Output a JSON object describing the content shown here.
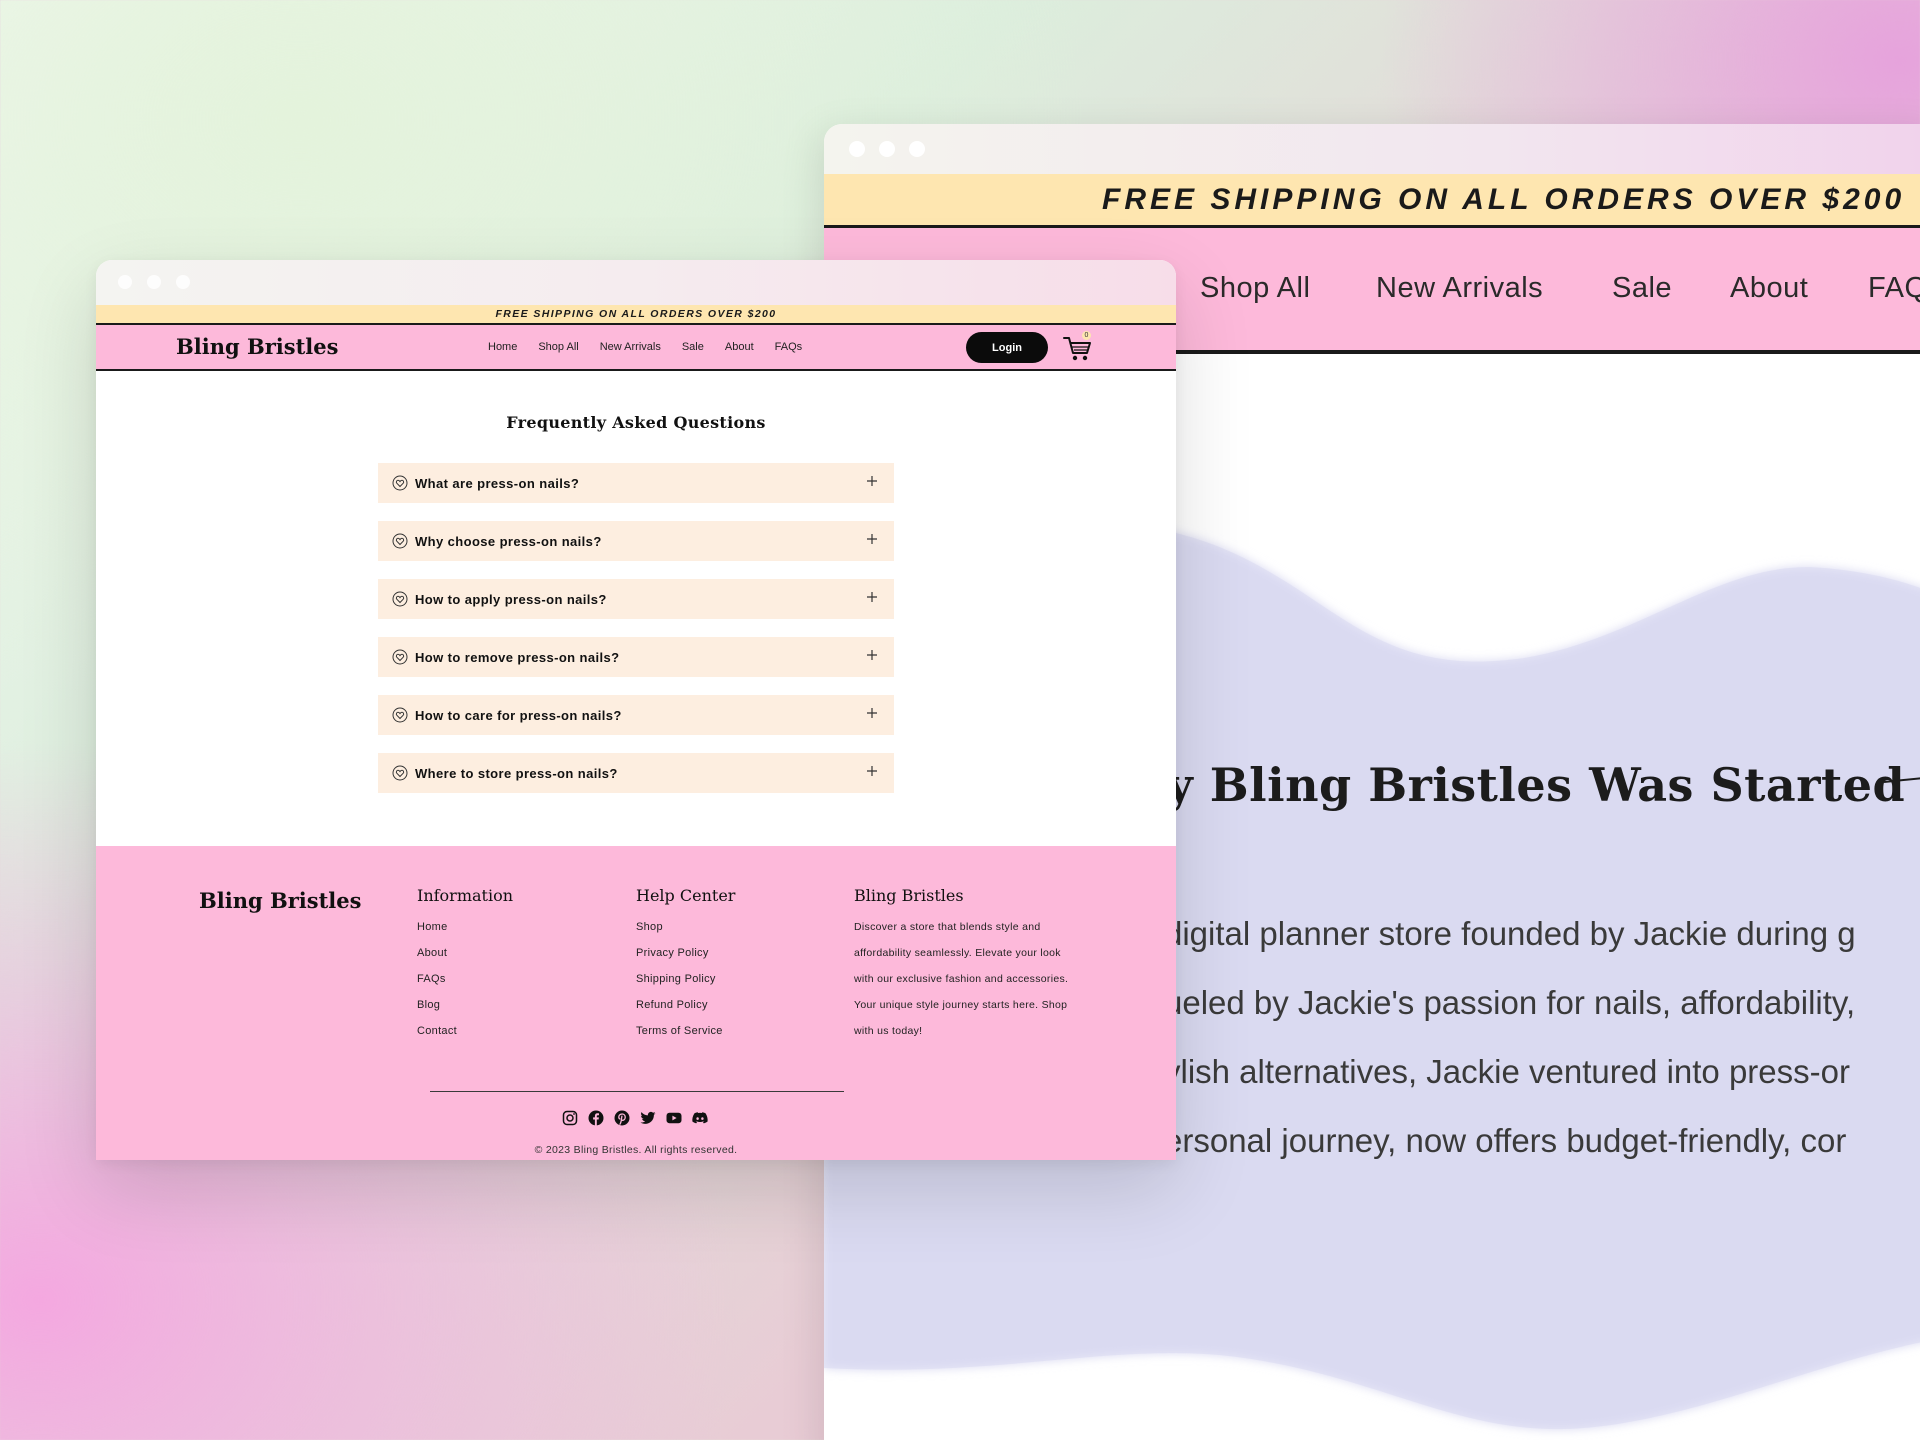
{
  "colors": {
    "pink": "#fdb9da",
    "cream_banner": "#fee6b0",
    "faq_item_bg": "#fdeee0",
    "lavender_wave": "#d9d9f1",
    "dark": "#0b0b0b"
  },
  "back_window": {
    "banner": "FREE SHIPPING ON ALL ORDERS OVER $200",
    "nav": [
      "Shop All",
      "New Arrivals",
      "Sale",
      "About",
      "FAQ"
    ],
    "heading": "y Bling Bristles Was Started",
    "paragraph_lines": [
      "digital planner store founded by Jackie during g",
      "ueled by Jackie's passion for nails, affordability,",
      "ylish alternatives, Jackie ventured into press-or",
      "ersonal journey, now offers budget-friendly, cor"
    ]
  },
  "front_window": {
    "banner": "FREE SHIPPING ON ALL ORDERS OVER $200",
    "brand": "Bling Bristles",
    "nav": [
      "Home",
      "Shop All",
      "New Arrivals",
      "Sale",
      "About",
      "FAQs"
    ],
    "login_label": "Login",
    "cart_count": "0",
    "faq_title": "Frequently Asked Questions",
    "faqs": [
      "What are press-on nails?",
      "Why choose press-on nails?",
      "How to apply press-on nails?",
      "How to remove press-on nails?",
      "How to care for press-on nails?",
      "Where to store press-on nails?"
    ],
    "footer": {
      "brand": "Bling Bristles",
      "information": {
        "heading": "Information",
        "links": [
          "Home",
          "About",
          "FAQs",
          "Blog",
          "Contact"
        ]
      },
      "help_center": {
        "heading": "Help Center",
        "links": [
          "Shop",
          "Privacy Policy",
          "Shipping Policy",
          "Refund Policy",
          "Terms of Service"
        ]
      },
      "about": {
        "heading": "Bling Bristles",
        "blurb": "Discover a store that blends style and affordability seamlessly. Elevate your look with our exclusive fashion and accessories. Your unique style journey starts here. Shop with us today!"
      },
      "socials": [
        "instagram-icon",
        "facebook-icon",
        "pinterest-icon",
        "twitter-icon",
        "youtube-icon",
        "discord-icon"
      ],
      "copyright": "© 2023 Bling Bristles. All rights reserved."
    }
  }
}
